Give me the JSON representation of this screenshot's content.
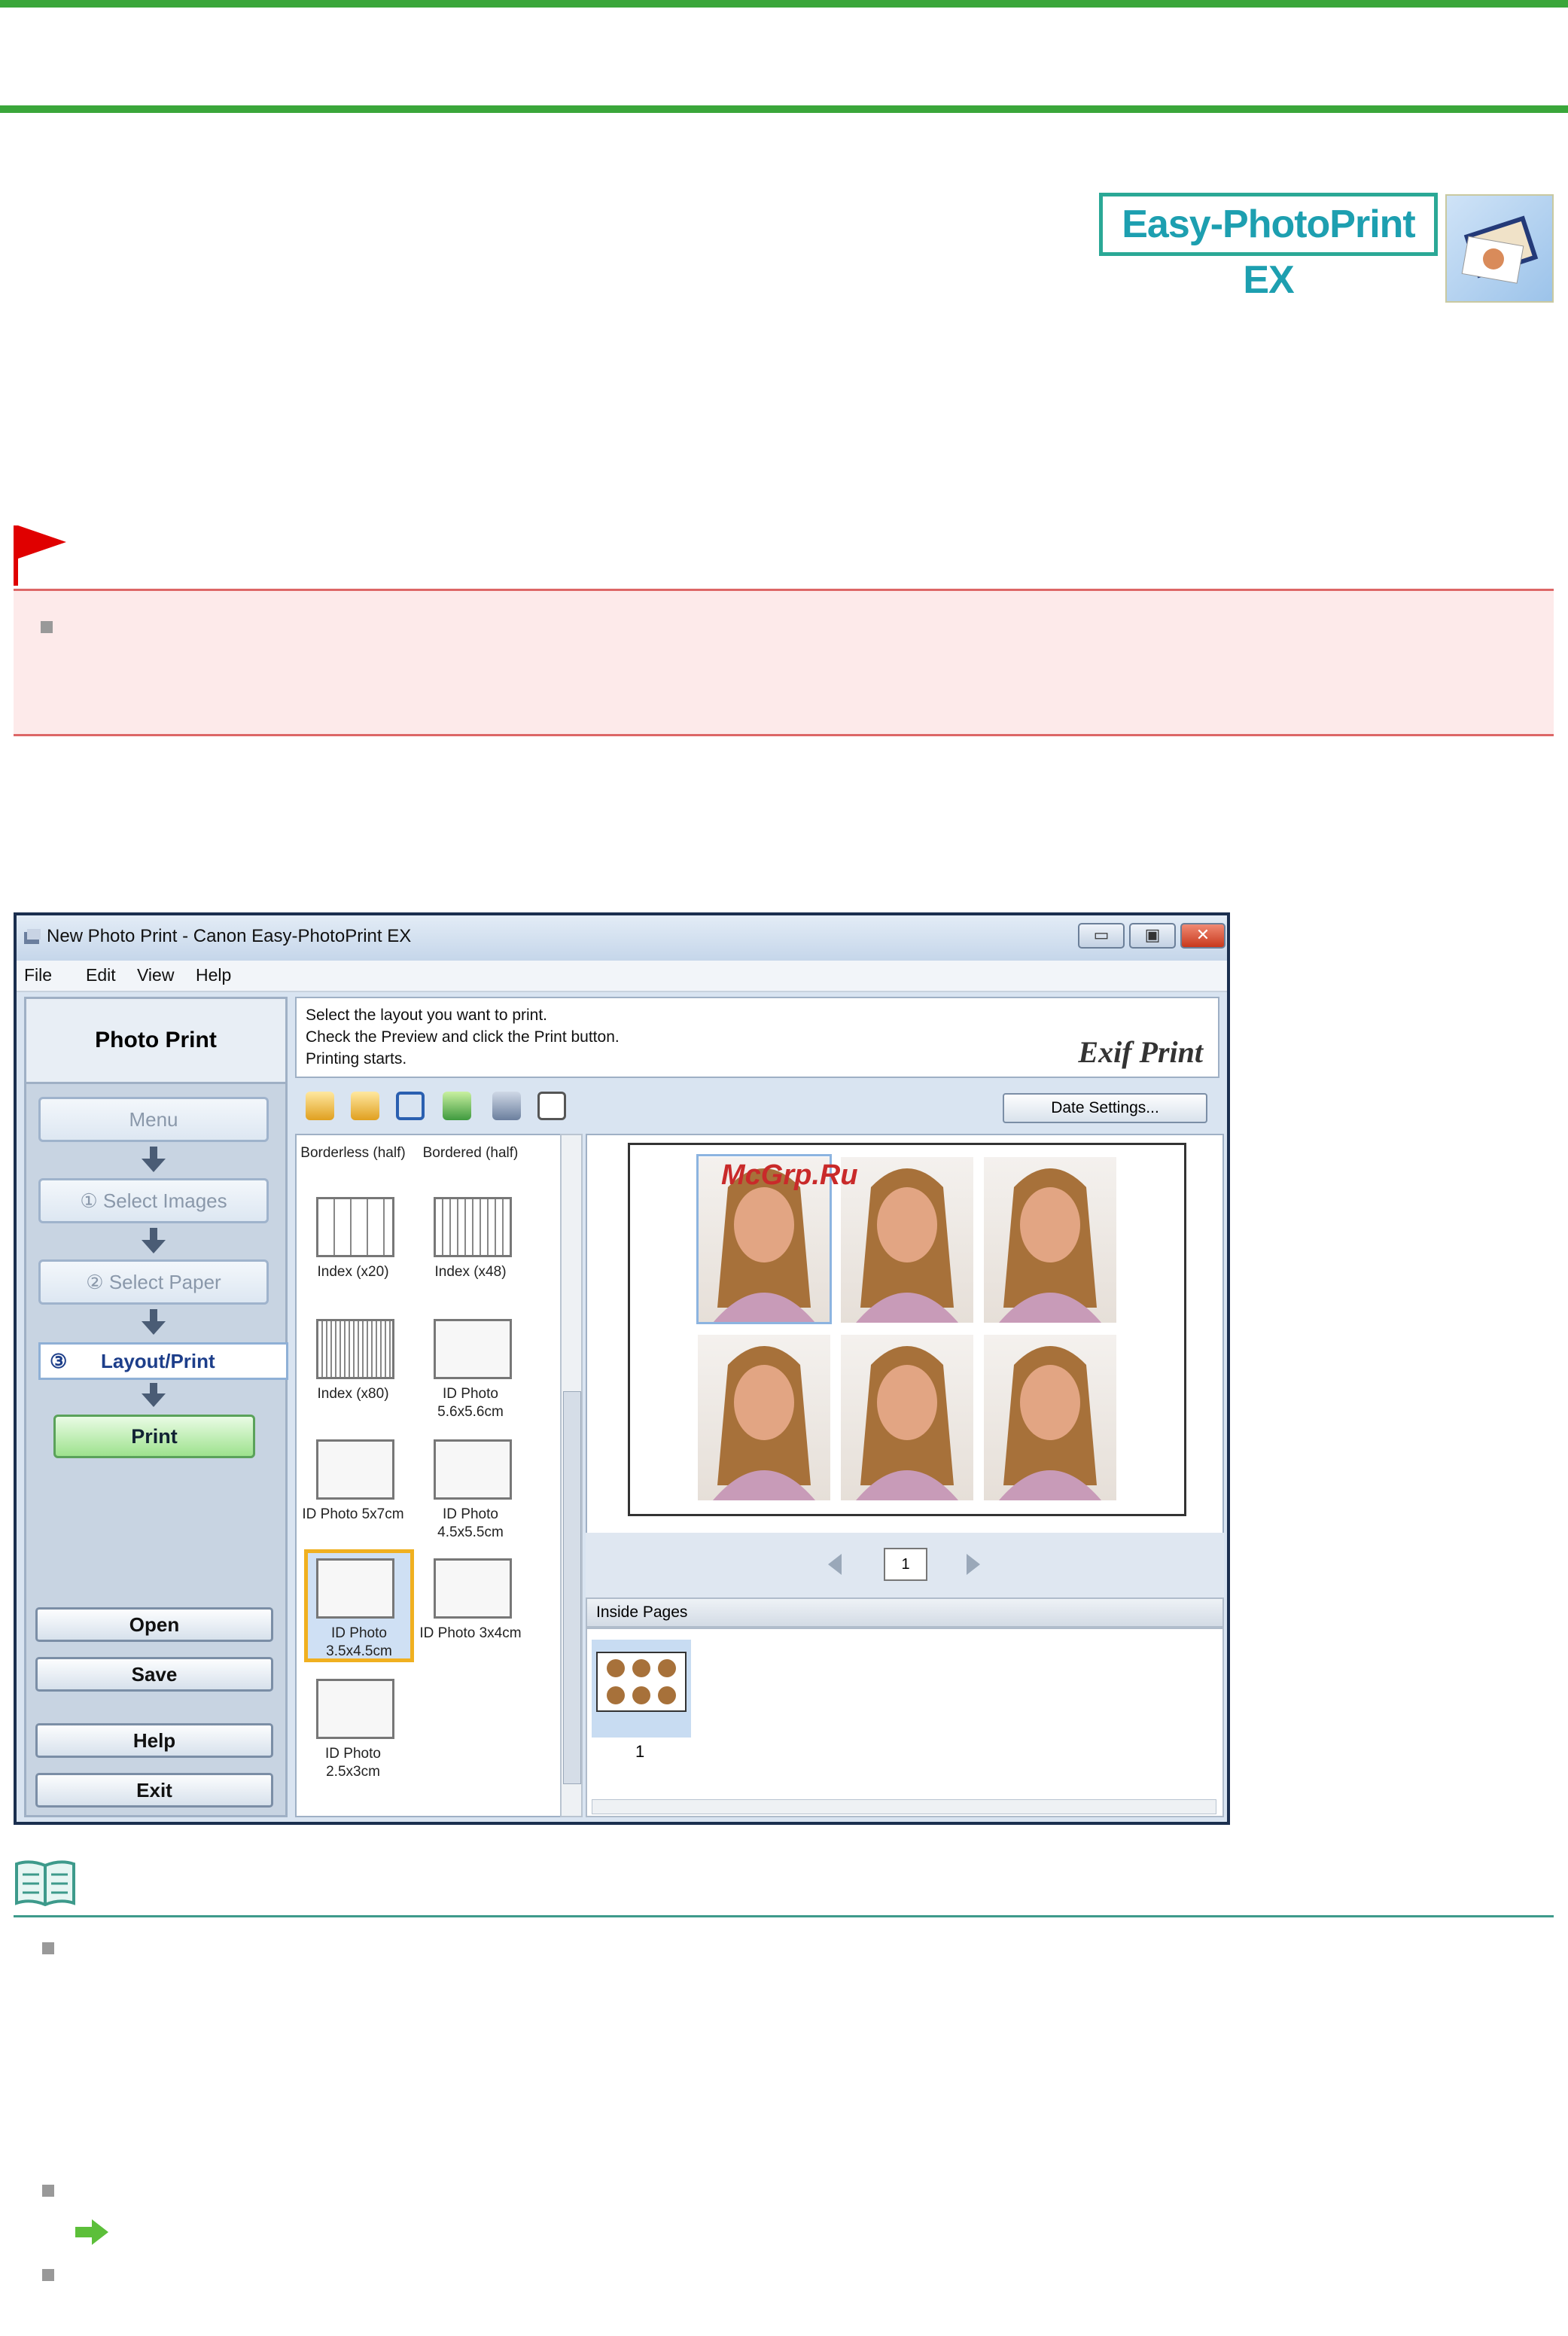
{
  "logo": {
    "text": "Easy-PhotoPrint EX"
  },
  "window": {
    "title": "New Photo Print - Canon Easy-PhotoPrint EX",
    "menu": [
      "File",
      "Edit",
      "View",
      "Help"
    ],
    "left_panel": {
      "heading": "Photo Print",
      "menu_button": "Menu",
      "step1": "① Select Images",
      "step2": "② Select Paper",
      "step3_num": "③",
      "step3": "Layout/Print",
      "print_button": "Print",
      "open_button": "Open",
      "save_button": "Save",
      "help_button": "Help",
      "exit_button": "Exit"
    },
    "instructions": [
      "Select the layout you want to print.",
      "Check the Preview and click the Print button.",
      "Printing starts."
    ],
    "exif_logo": "Exif Print",
    "date_settings_button": "Date Settings...",
    "layouts": [
      "Borderless (half)",
      "Bordered (half)",
      "Index (x20)",
      "Index (x48)",
      "Index (x80)",
      "ID Photo 5.6x5.6cm",
      "ID Photo 5x7cm",
      "ID Photo 4.5x5.5cm",
      "ID Photo 3.5x4.5cm",
      "ID Photo 3x4cm",
      "ID Photo 2.5x3cm"
    ],
    "selected_layout": "ID Photo 3.5x4.5cm",
    "page_number": "1",
    "inside_pages_label": "Inside Pages",
    "thumbnail_number": "1"
  },
  "watermark": "McGrp.Ru",
  "colors": {
    "header_green": "#3aa63a",
    "important_red": "#e00000",
    "note_teal": "#3d9a8b",
    "logo_teal": "#1d9fb0"
  }
}
